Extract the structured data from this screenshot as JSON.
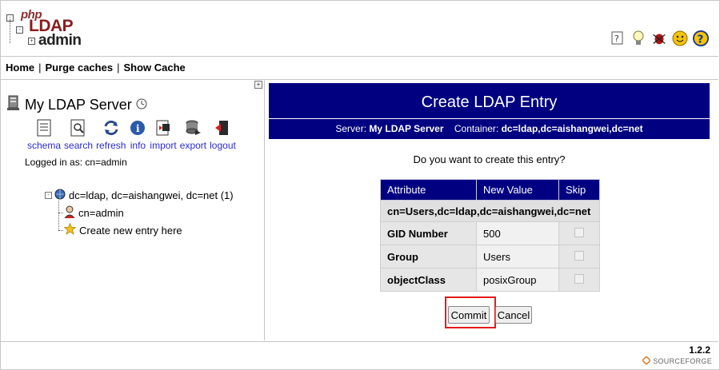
{
  "logo": {
    "php": "php",
    "ldap": "LDAP",
    "admin": "admin"
  },
  "top_icons": [
    "help-icon",
    "hint-bulb-icon",
    "bug-icon",
    "smiley-icon",
    "question-icon"
  ],
  "menu": {
    "home": "Home",
    "purge": "Purge caches",
    "show_cache": "Show Cache",
    "separator": "|"
  },
  "server": {
    "name": "My LDAP Server",
    "logged_in": "Logged in as: cn=admin"
  },
  "tools": [
    {
      "label": "schema",
      "icon": "schema-icon"
    },
    {
      "label": "search",
      "icon": "search-icon"
    },
    {
      "label": "refresh",
      "icon": "refresh-icon"
    },
    {
      "label": "info",
      "icon": "info-icon"
    },
    {
      "label": "import",
      "icon": "import-icon"
    },
    {
      "label": "export",
      "icon": "export-icon"
    },
    {
      "label": "logout",
      "icon": "logout-icon"
    }
  ],
  "tree": {
    "root": "dc=ldap, dc=aishangwei, dc=net (1)",
    "children": [
      "cn=admin",
      "Create new entry here"
    ]
  },
  "panel": {
    "title": "Create LDAP Entry",
    "server_label": "Server:",
    "server_value": "My LDAP Server",
    "container_label": "Container:",
    "container_value": "dc=ldap,dc=aishangwei,dc=net",
    "question": "Do you want to create this entry?"
  },
  "table": {
    "headers": [
      "Attribute",
      "New Value",
      "Skip"
    ],
    "dn": "cn=Users,dc=ldap,dc=aishangwei,dc=net",
    "rows": [
      {
        "attribute": "GID Number",
        "value": "500"
      },
      {
        "attribute": "Group",
        "value": "Users"
      },
      {
        "attribute": "objectClass",
        "value": "posixGroup"
      }
    ]
  },
  "buttons": {
    "commit": "Commit",
    "cancel": "Cancel"
  },
  "footer": {
    "version": "1.2.2",
    "sourceforge": "SOURCEFORGE"
  },
  "colors": {
    "header_bg": "#000080",
    "link": "#2b2bd6",
    "highlight": "#e31b1b"
  }
}
